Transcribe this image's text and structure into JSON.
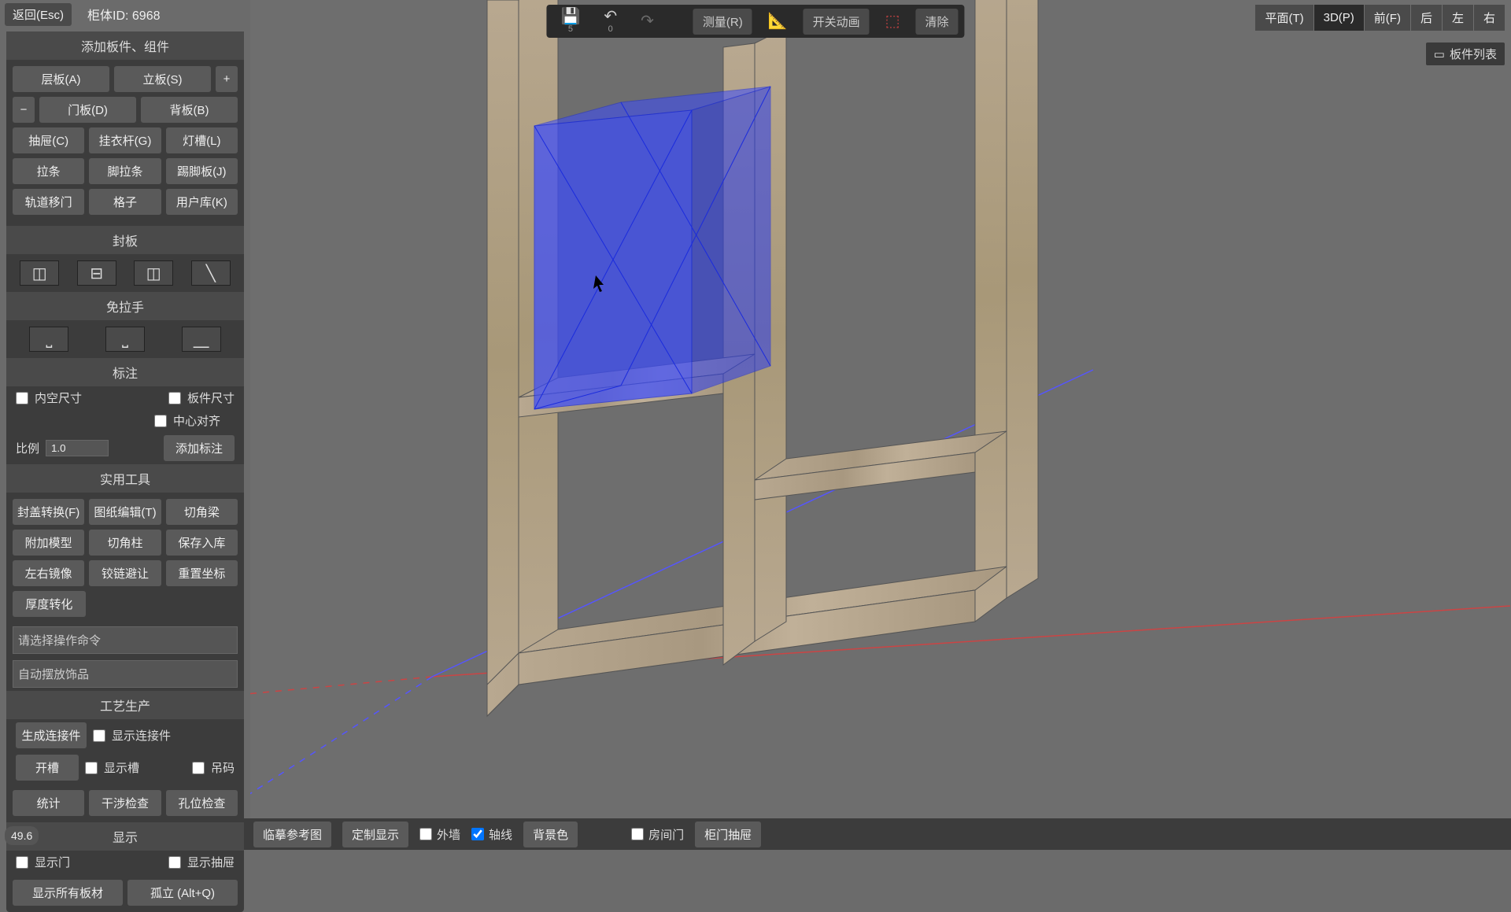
{
  "top": {
    "back": "返回(Esc)",
    "cabinet_id_label": "柜体ID:",
    "cabinet_id": "6968"
  },
  "center_toolbar": {
    "save_sub": "5",
    "undo_sub": "0",
    "measure": "测量(R)",
    "anim": "开关动画",
    "clear": "清除"
  },
  "views": {
    "plan": "平面(T)",
    "v3d": "3D(P)",
    "front": "前(F)",
    "back": "后",
    "left": "左",
    "right": "右"
  },
  "right_mini": {
    "label": "板件列表"
  },
  "panel": {
    "add_title": "添加板件、组件",
    "buttons": {
      "shelf": "层板(A)",
      "vertical": "立板(S)",
      "door": "门板(D)",
      "back": "背板(B)",
      "drawer": "抽屉(C)",
      "rod": "挂衣杆(G)",
      "light": "灯槽(L)",
      "strip": "拉条",
      "kickstrip": "脚拉条",
      "kick": "踢脚板(J)",
      "slide": "轨道移门",
      "grid": "格子",
      "userlib": "用户库(K)"
    },
    "seal_title": "封板",
    "handle_title": "免拉手",
    "annot_title": "标注",
    "annot": {
      "inner": "内空尺寸",
      "panel": "板件尺寸",
      "center": "中心对齐",
      "scale_label": "比例",
      "scale_value": "1.0",
      "add": "添加标注"
    },
    "tools_title": "实用工具",
    "tools": {
      "cover": "封盖转换(F)",
      "drawing": "图纸编辑(T)",
      "cutbeam": "切角梁",
      "attach": "附加模型",
      "cutcol": "切角柱",
      "save": "保存入库",
      "mirror": "左右镜像",
      "hinge": "铰链避让",
      "reset": "重置坐标",
      "thick": "厚度转化"
    },
    "select1": "请选择操作命令",
    "select2": "自动摆放饰品",
    "craft_title": "工艺生产",
    "craft": {
      "gen": "生成连接件",
      "show_conn": "显示连接件",
      "slot": "开槽",
      "show_slot": "显示槽",
      "code": "吊码",
      "stat": "统计",
      "interf": "干涉检查",
      "hole": "孔位检查"
    },
    "display_title": "显示",
    "display": {
      "door": "显示门",
      "drawer": "显示抽屉",
      "all": "显示所有板材",
      "isolate": "孤立 (Alt+Q)"
    }
  },
  "bottom": {
    "ref": "临摹参考图",
    "custom": "定制显示",
    "wall": "外墙",
    "axis": "轴线",
    "bg": "背景色",
    "roomdoor": "房间门",
    "cabdoor": "柜门抽屉"
  },
  "badge": "49.6"
}
